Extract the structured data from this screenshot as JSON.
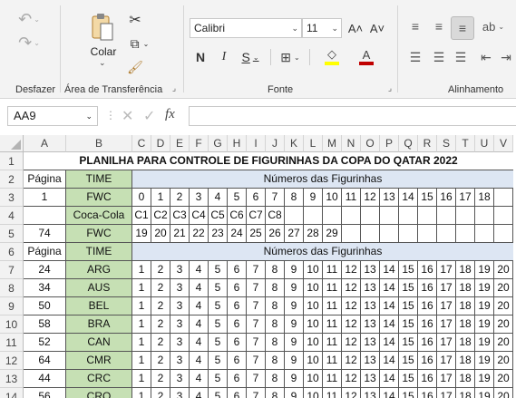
{
  "ribbon": {
    "undo_label": "Desfazer",
    "clipboard": {
      "label": "Área de Transferência",
      "paste_label": "Colar"
    },
    "font": {
      "label": "Fonte",
      "font_name": "Calibri",
      "font_size": "11",
      "bold": "N",
      "italic": "I",
      "underline": "S",
      "grow": "A˄",
      "shrink": "A˅"
    },
    "alignment": {
      "label": "Alinhamento"
    }
  },
  "formula_bar": {
    "name_box": "AA9",
    "fx": "fx",
    "value": ""
  },
  "columns": [
    "A",
    "B",
    "C",
    "D",
    "E",
    "F",
    "G",
    "H",
    "I",
    "J",
    "K",
    "L",
    "M",
    "N",
    "O",
    "P",
    "Q",
    "R",
    "S",
    "T",
    "U",
    "V"
  ],
  "rows": [
    "1",
    "2",
    "3",
    "4",
    "5",
    "6",
    "7",
    "8",
    "9",
    "10",
    "11",
    "12",
    "13",
    "14"
  ],
  "sheet": {
    "title": "PLANILHA PARA CONTROLE DE FIGURINHAS DA COPA DO QATAR 2022",
    "header_pagina": "Página",
    "header_time": "TIME",
    "header_numeros": "Números das Figurinhas",
    "block1": [
      {
        "pagina": "1",
        "time": "FWC",
        "nums": [
          "0",
          "1",
          "2",
          "3",
          "4",
          "5",
          "6",
          "7",
          "8",
          "9",
          "10",
          "11",
          "12",
          "13",
          "14",
          "15",
          "16",
          "17",
          "18",
          ""
        ]
      },
      {
        "pagina": "",
        "time": "Coca-Cola",
        "nums": [
          "C1",
          "C2",
          "C3",
          "C4",
          "C5",
          "C6",
          "C7",
          "C8",
          "",
          "",
          "",
          "",
          "",
          "",
          "",
          "",
          "",
          "",
          "",
          ""
        ]
      },
      {
        "pagina": "74",
        "time": "FWC",
        "nums": [
          "19",
          "20",
          "21",
          "22",
          "23",
          "24",
          "25",
          "26",
          "27",
          "28",
          "29",
          "",
          "",
          "",
          "",
          "",
          "",
          "",
          "",
          ""
        ]
      }
    ],
    "block2": [
      {
        "pagina": "24",
        "time": "ARG",
        "nums": [
          "1",
          "2",
          "3",
          "4",
          "5",
          "6",
          "7",
          "8",
          "9",
          "10",
          "11",
          "12",
          "13",
          "14",
          "15",
          "16",
          "17",
          "18",
          "19",
          "20"
        ]
      },
      {
        "pagina": "34",
        "time": "AUS",
        "nums": [
          "1",
          "2",
          "3",
          "4",
          "5",
          "6",
          "7",
          "8",
          "9",
          "10",
          "11",
          "12",
          "13",
          "14",
          "15",
          "16",
          "17",
          "18",
          "19",
          "20"
        ]
      },
      {
        "pagina": "50",
        "time": "BEL",
        "nums": [
          "1",
          "2",
          "3",
          "4",
          "5",
          "6",
          "7",
          "8",
          "9",
          "10",
          "11",
          "12",
          "13",
          "14",
          "15",
          "16",
          "17",
          "18",
          "19",
          "20"
        ]
      },
      {
        "pagina": "58",
        "time": "BRA",
        "nums": [
          "1",
          "2",
          "3",
          "4",
          "5",
          "6",
          "7",
          "8",
          "9",
          "10",
          "11",
          "12",
          "13",
          "14",
          "15",
          "16",
          "17",
          "18",
          "19",
          "20"
        ]
      },
      {
        "pagina": "52",
        "time": "CAN",
        "nums": [
          "1",
          "2",
          "3",
          "4",
          "5",
          "6",
          "7",
          "8",
          "9",
          "10",
          "11",
          "12",
          "13",
          "14",
          "15",
          "16",
          "17",
          "18",
          "19",
          "20"
        ]
      },
      {
        "pagina": "64",
        "time": "CMR",
        "nums": [
          "1",
          "2",
          "3",
          "4",
          "5",
          "6",
          "7",
          "8",
          "9",
          "10",
          "11",
          "12",
          "13",
          "14",
          "15",
          "16",
          "17",
          "18",
          "19",
          "20"
        ]
      },
      {
        "pagina": "44",
        "time": "CRC",
        "nums": [
          "1",
          "2",
          "3",
          "4",
          "5",
          "6",
          "7",
          "8",
          "9",
          "10",
          "11",
          "12",
          "13",
          "14",
          "15",
          "16",
          "17",
          "18",
          "19",
          "20"
        ]
      },
      {
        "pagina": "56",
        "time": "CRO",
        "nums": [
          "1",
          "2",
          "3",
          "4",
          "5",
          "6",
          "7",
          "8",
          "9",
          "10",
          "11",
          "12",
          "13",
          "14",
          "15",
          "16",
          "17",
          "18",
          "19",
          "20"
        ]
      }
    ]
  },
  "colors": {
    "team_green": "#c6e0b4",
    "header_blue": "#dde6f3",
    "font_color_red": "#c00000",
    "highlight_yellow": "#ffff00"
  }
}
